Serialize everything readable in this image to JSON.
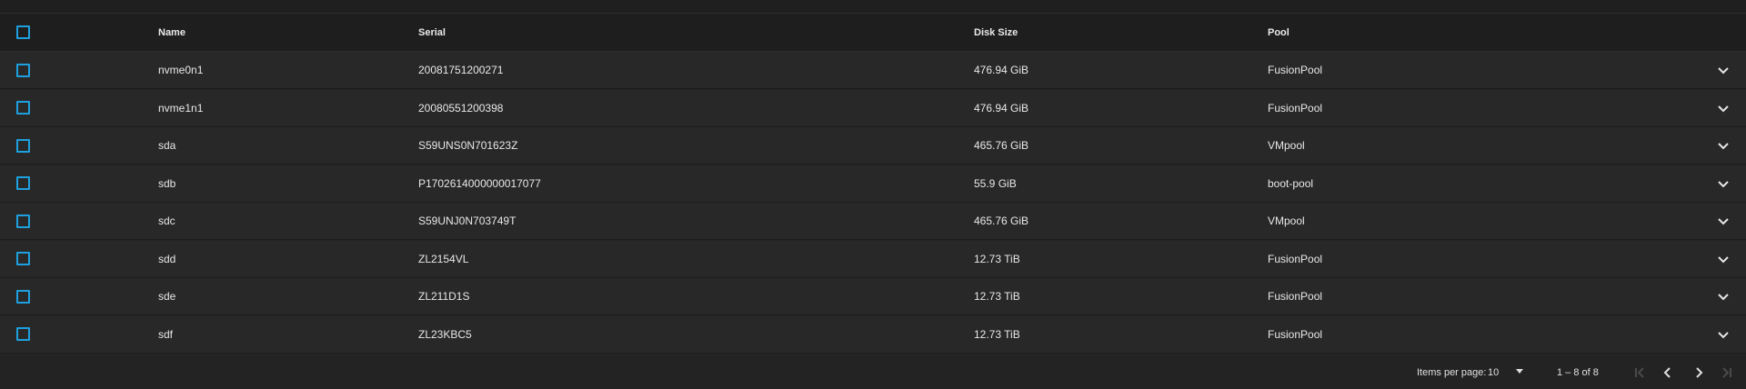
{
  "table": {
    "columns": {
      "name": "Name",
      "serial": "Serial",
      "disk_size": "Disk Size",
      "pool": "Pool"
    },
    "rows": [
      {
        "name": "nvme0n1",
        "serial": "20081751200271",
        "disk_size": "476.94 GiB",
        "pool": "FusionPool"
      },
      {
        "name": "nvme1n1",
        "serial": "20080551200398",
        "disk_size": "476.94 GiB",
        "pool": "FusionPool"
      },
      {
        "name": "sda",
        "serial": "S59UNS0N701623Z",
        "disk_size": "465.76 GiB",
        "pool": "VMpool"
      },
      {
        "name": "sdb",
        "serial": "P1702614000000017077",
        "disk_size": "55.9 GiB",
        "pool": "boot-pool"
      },
      {
        "name": "sdc",
        "serial": "S59UNJ0N703749T",
        "disk_size": "465.76 GiB",
        "pool": "VMpool"
      },
      {
        "name": "sdd",
        "serial": "ZL2154VL",
        "disk_size": "12.73 TiB",
        "pool": "FusionPool"
      },
      {
        "name": "sde",
        "serial": "ZL211D1S",
        "disk_size": "12.73 TiB",
        "pool": "FusionPool"
      },
      {
        "name": "sdf",
        "serial": "ZL23KBC5",
        "disk_size": "12.73 TiB",
        "pool": "FusionPool"
      }
    ]
  },
  "paginator": {
    "items_per_page_label": "Items per page:",
    "items_per_page_value": "10",
    "range_label": "1 – 8 of 8"
  },
  "icons": {
    "checkbox": "checkbox-icon",
    "expand": "chevron-down-icon",
    "first_page": "first-page-icon",
    "prev_page": "chevron-left-icon",
    "next_page": "chevron-right-icon",
    "last_page": "last-page-icon",
    "select_arrow": "caret-down-icon"
  },
  "colors": {
    "accent": "#1ea0de",
    "background": "#242424",
    "row": "#282828",
    "header": "#1e1e1e"
  }
}
